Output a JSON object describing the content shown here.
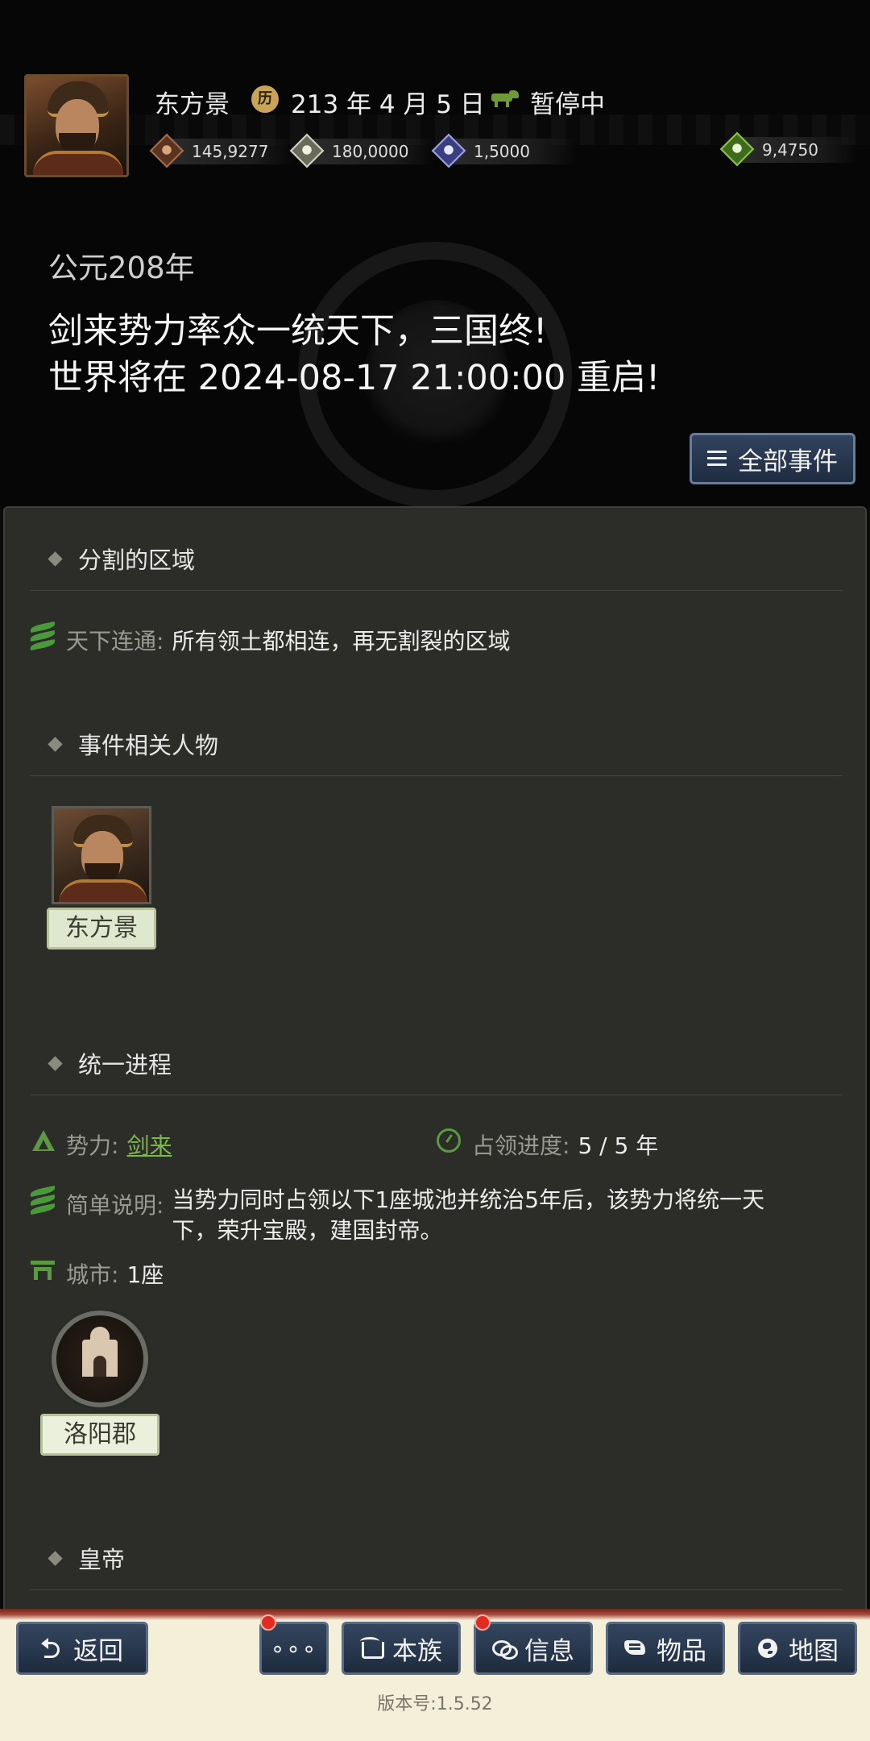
{
  "header": {
    "player_name": "东方景",
    "game_date": "213 年 4 月 5 日",
    "status": "暂停中",
    "resources": {
      "gold": "145,9277",
      "grain": "180,0000",
      "troops": "1,5000",
      "special": "9,4750"
    },
    "era": "公元208年",
    "announcement_line1": "剑来势力率众一统天下，三国终!",
    "announcement_line2": "世界将在 2024-08-17 21:00:00 重启!",
    "all_events_label": "全部事件"
  },
  "sections": {
    "split_regions": {
      "title": "分割的区域",
      "label": "天下连通:",
      "text": "所有领土都相连，再无割裂的区域"
    },
    "related_people": {
      "title": "事件相关人物",
      "person_name": "东方景"
    },
    "unification": {
      "title": "统一进程",
      "faction_label": "势力:",
      "faction_value": "剑来",
      "progress_label": "占领进度:",
      "progress_value": "5 / 5 年",
      "desc_label": "简单说明:",
      "desc_line1": "当势力同时占领以下1座城池并统治5年后，该势力将统一天",
      "desc_line2": "下，荣升宝殿，建国封帝。",
      "city_label": "城市:",
      "city_count": "1座",
      "city_name": "洛阳郡"
    },
    "emperor": {
      "title": "皇帝"
    }
  },
  "bottom_nav": {
    "back": "返回",
    "more": "∘∘∘",
    "clan": "本族",
    "info": "信息",
    "items": "物品",
    "map": "地图"
  },
  "version": "版本号:1.5.52"
}
